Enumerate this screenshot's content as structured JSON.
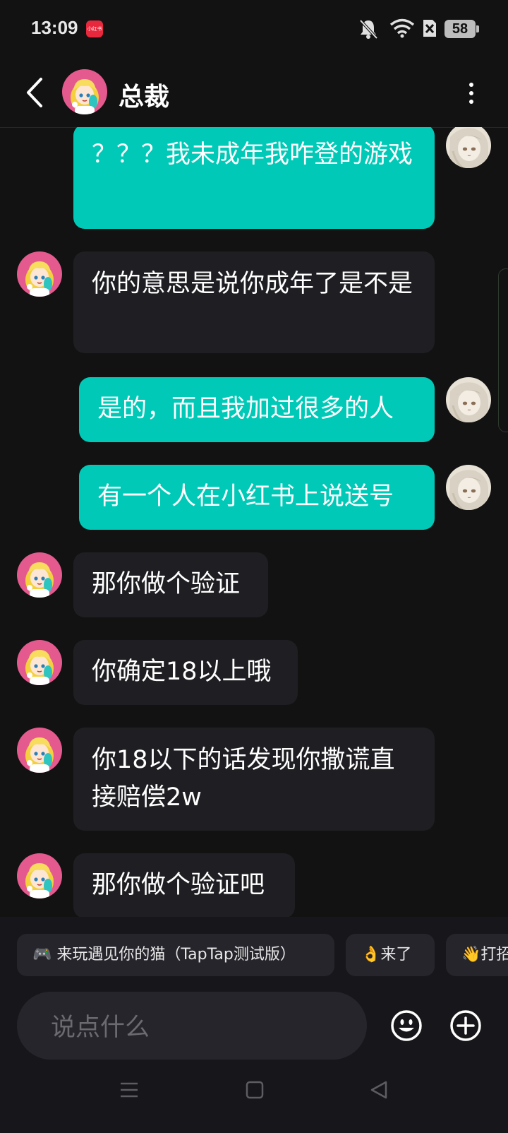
{
  "status_bar": {
    "time": "13:09",
    "app_badge": "小红书",
    "battery": "58",
    "icons": [
      "mute-bell-icon",
      "wifi-icon",
      "sim-x-icon",
      "battery-icon"
    ]
  },
  "header": {
    "title": "总裁",
    "back_icon": "chevron-left-icon",
    "more_icon": "more-vertical-icon"
  },
  "messages": [
    {
      "side": "out",
      "text": "？？？我未成年我咋登的游戏"
    },
    {
      "side": "in",
      "text": "你的意思是说你成年了是不是"
    },
    {
      "side": "out",
      "text": "是的，而且我加过很多的人"
    },
    {
      "side": "out",
      "text": "有一个人在小红书上说送号"
    },
    {
      "side": "in",
      "text": "那你做个验证"
    },
    {
      "side": "in",
      "text": "你确定18以上哦"
    },
    {
      "side": "in",
      "text": "你18以下的话发现你撒谎直接赔偿2w"
    },
    {
      "side": "in",
      "text": "那你做个验证吧"
    }
  ],
  "quick_replies": [
    "🎮 来玩遇见你的猫（TapTap测试版）",
    "👌来了",
    "👋打招呼"
  ],
  "composer": {
    "placeholder": "说点什么",
    "emoji_icon": "emoji-smile-icon",
    "plus_icon": "plus-circle-icon"
  },
  "nav_bar": [
    "menu-icon",
    "home-square-icon",
    "back-triangle-icon"
  ],
  "colors": {
    "background": "#121212",
    "outgoing_bubble": "#00c9b7",
    "incoming_bubble": "#1f1f23",
    "bottom_panel": "#17171b"
  }
}
